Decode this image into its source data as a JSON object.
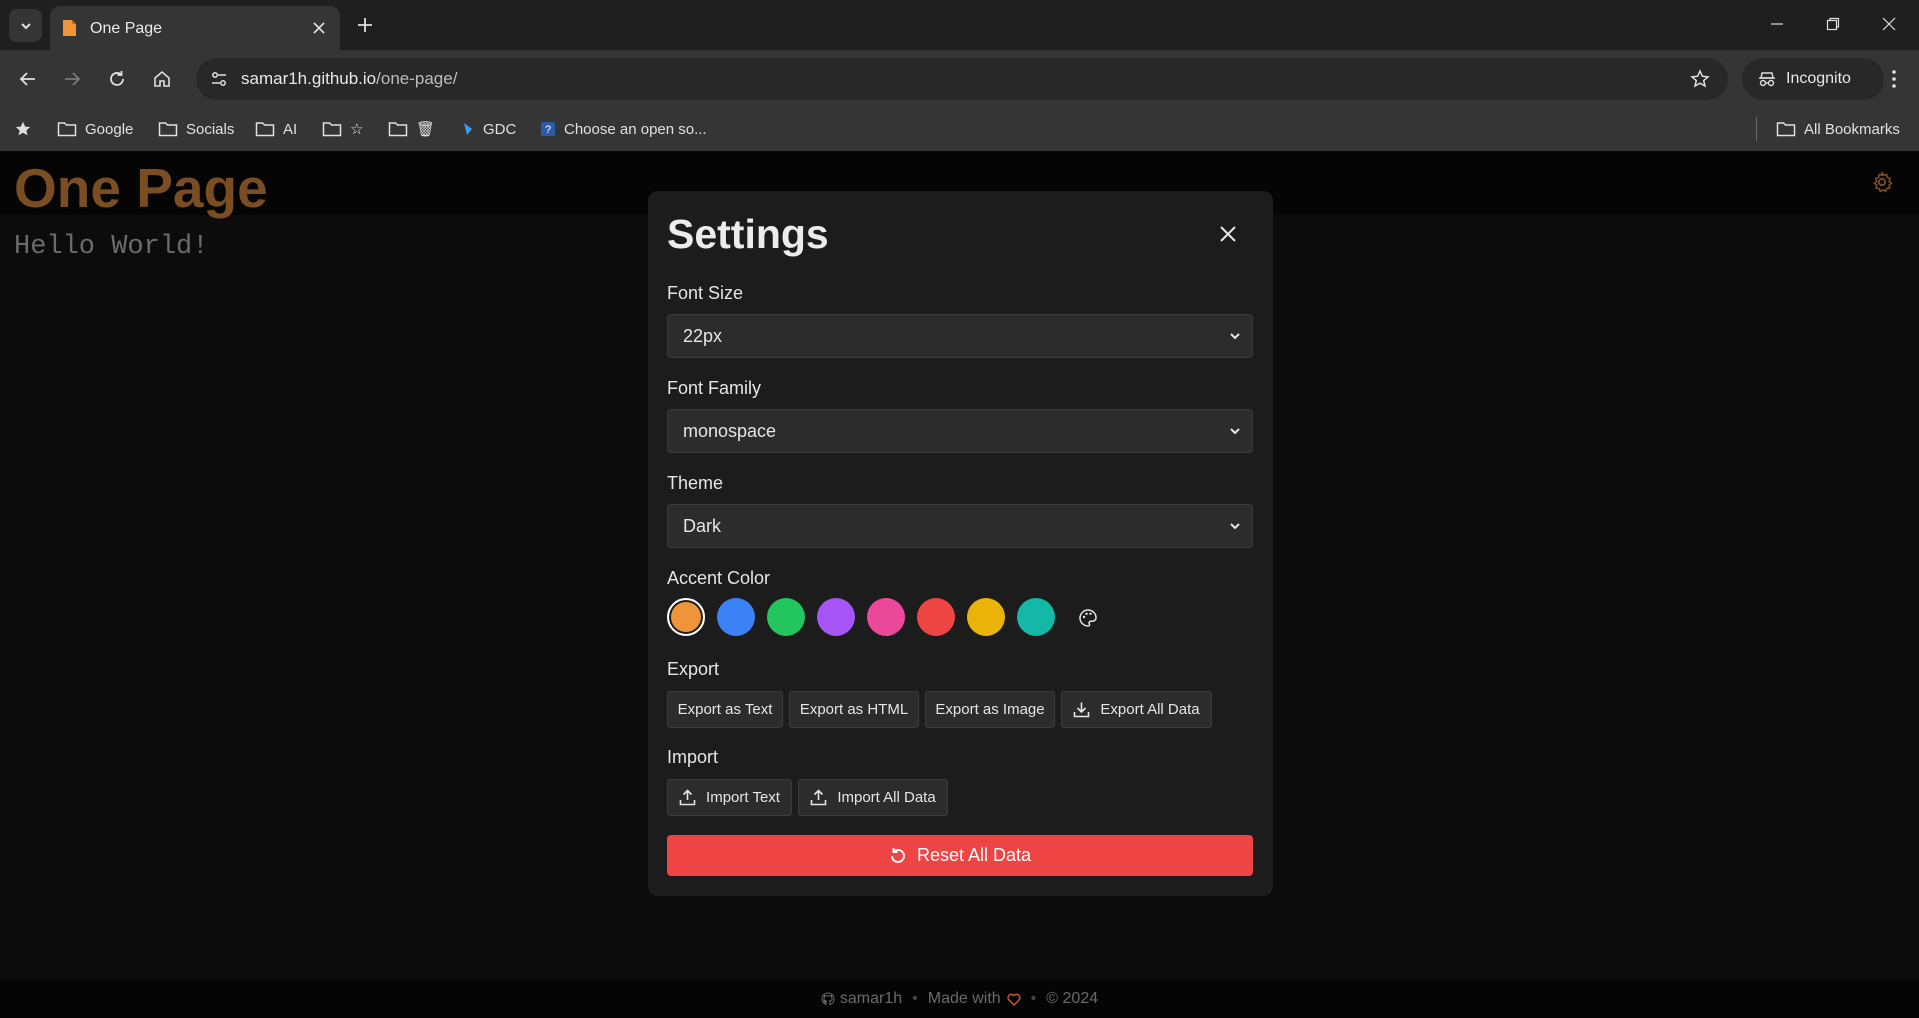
{
  "browser": {
    "tab": {
      "title": "One Page"
    },
    "url": {
      "host": "samar1h.github.io",
      "path": "/one-page/"
    },
    "incognito_label": "Incognito",
    "bookmarks": [
      {
        "label": "Google",
        "icon": "folder-icon"
      },
      {
        "label": "Socials",
        "icon": "folder-icon"
      },
      {
        "label": "AI",
        "icon": "folder-icon"
      },
      {
        "label": "☆",
        "icon": "folder-icon"
      },
      {
        "label": "🗑",
        "icon": "folder-icon"
      },
      {
        "label": "GDC",
        "icon": "gdc-icon"
      },
      {
        "label": "Choose an open so...",
        "icon": "question-icon"
      }
    ],
    "all_bookmarks_label": "All Bookmarks"
  },
  "page": {
    "title": "One Page",
    "editor_text": "Hello World!",
    "accent": "#f0943a"
  },
  "settings": {
    "title": "Settings",
    "font_size": {
      "label": "Font Size",
      "value": "22px"
    },
    "font_family": {
      "label": "Font Family",
      "value": "monospace"
    },
    "theme": {
      "label": "Theme",
      "value": "Dark"
    },
    "accent": {
      "label": "Accent Color",
      "colors": [
        "#f0943a",
        "#3b82f6",
        "#22c55e",
        "#a855f7",
        "#ec4899",
        "#ef4444",
        "#eab308",
        "#14b8a6"
      ],
      "selected_index": 0
    },
    "export": {
      "label": "Export",
      "buttons": [
        "Export as Text",
        "Export as HTML",
        "Export as Image",
        "Export All Data"
      ]
    },
    "import": {
      "label": "Import",
      "buttons": [
        "Import Text",
        "Import All Data"
      ]
    },
    "reset_label": "Reset All Data"
  },
  "footer": {
    "author": "samar1h",
    "made_with": "Made with",
    "copyright": "© 2024"
  }
}
